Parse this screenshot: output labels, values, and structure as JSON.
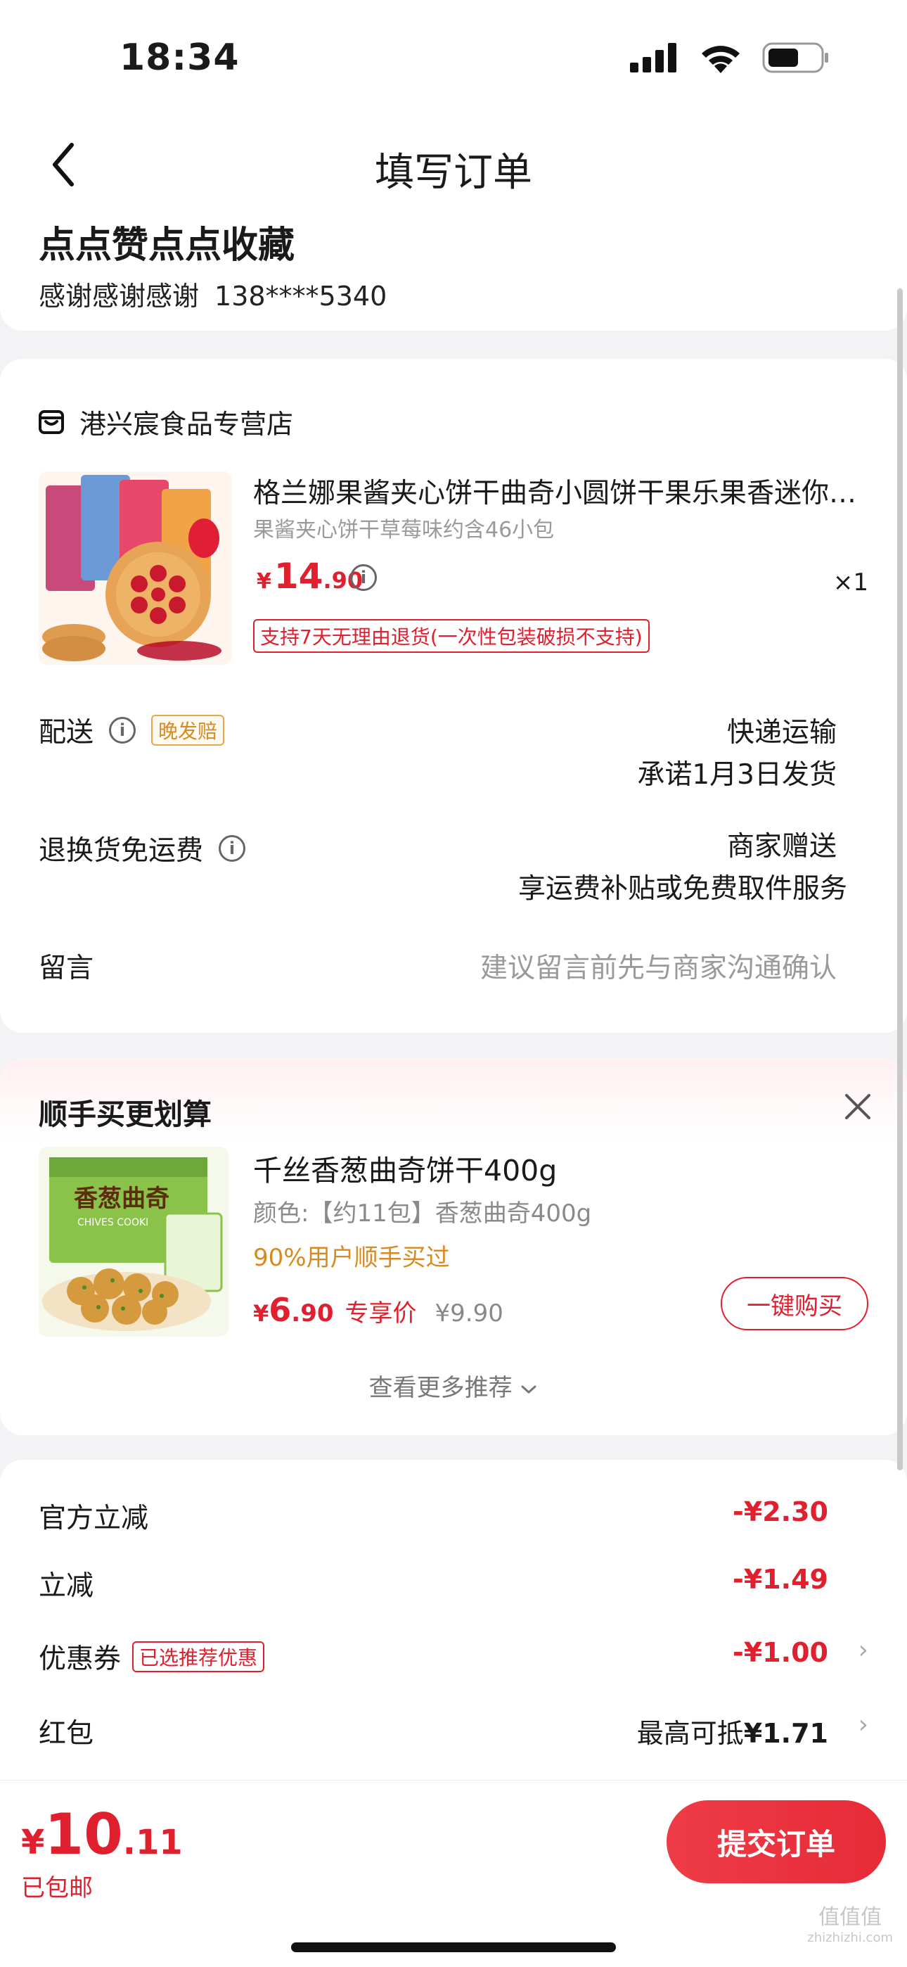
{
  "status_bar": {
    "time": "18:34"
  },
  "nav": {
    "title": "填写订单"
  },
  "address": {
    "name": "点点赞点点收藏",
    "recipient": "感谢感谢感谢",
    "phone": "138****5340"
  },
  "order": {
    "shop_name": "港兴宸食品专营店",
    "product": {
      "title": "格兰娜果酱夹心饼干曲奇小圆饼干果乐果香迷你…",
      "spec": "果酱夹心饼干草莓味约含46小包",
      "price_yen": "¥",
      "price_int": "14",
      "price_dec": ".90",
      "qty": "×1",
      "return_policy": "支持7天无理由退货(一次性包装破损不支持)"
    },
    "delivery": {
      "label": "配送",
      "badge": "晚发赔",
      "method": "快递运输",
      "promise": "承诺1月3日发货"
    },
    "return_shipping": {
      "label": "退换货免运费",
      "value": "商家赠送",
      "desc": "享运费补贴或免费取件服务"
    },
    "message": {
      "label": "留言",
      "placeholder": "建议留言前先与商家沟通确认"
    }
  },
  "upsell": {
    "title": "顺手买更划算",
    "name": "千丝香葱曲奇饼干400g",
    "spec": "颜色:【约11包】香葱曲奇400g",
    "hint": "90%用户顺手买过",
    "price_yen": "¥",
    "price_int": "6",
    "price_dec": ".90",
    "price_tag": "专享价",
    "orig_price": "¥9.90",
    "buy_label": "一键购买",
    "more_label": "查看更多推荐",
    "box_text": "香葱曲奇",
    "box_sub": "CHIVES COOKI"
  },
  "discounts": {
    "official": {
      "label": "官方立减",
      "value": "-¥2.30"
    },
    "instant": {
      "label": "立减",
      "value": "-¥1.49"
    },
    "coupon": {
      "label": "优惠券",
      "badge": "已选推荐优惠",
      "value": "-¥1.00"
    },
    "red_packet": {
      "label": "红包",
      "prefix": "最高可抵",
      "value": "¥1.71"
    }
  },
  "footer": {
    "total_yen": "¥",
    "total_int": "10",
    "total_dec": ".11",
    "shipping": "已包邮",
    "submit_label": "提交订单"
  },
  "watermark": {
    "text": "值值值",
    "sub": "zhizhizhi.com"
  },
  "colors": {
    "accent": "#e0202f",
    "orange": "#d98a1e",
    "background": "#f3f3f5"
  }
}
